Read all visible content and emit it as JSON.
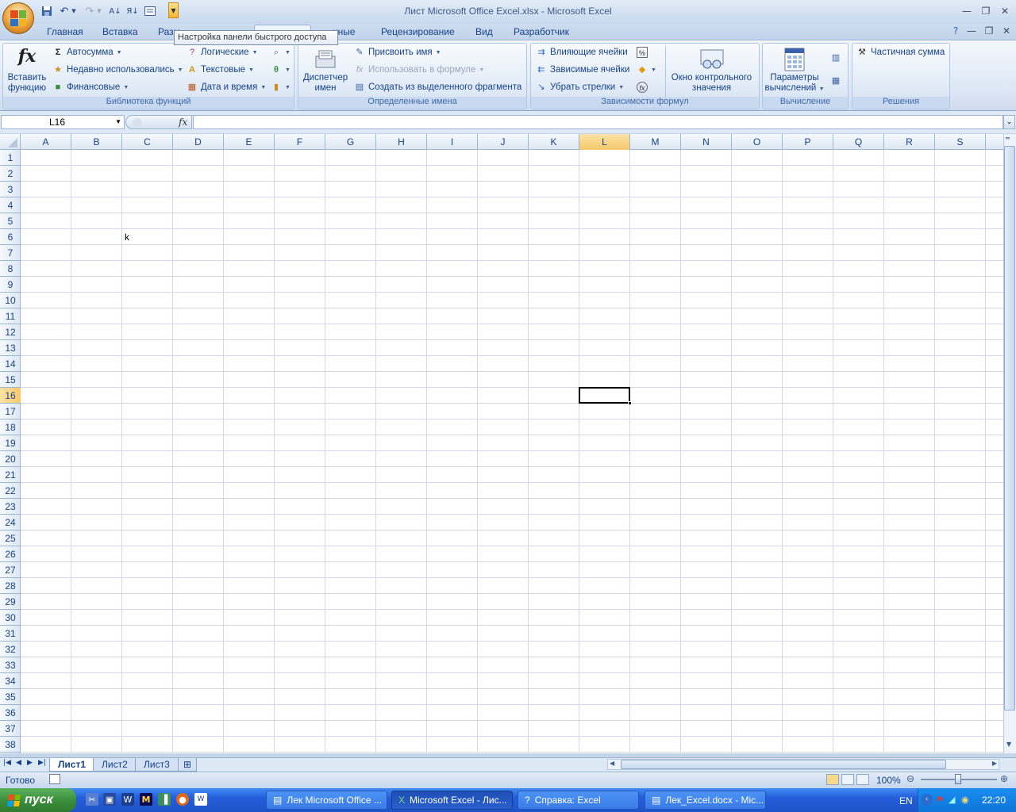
{
  "window": {
    "title": "Лист Microsoft Office Excel.xlsx - Microsoft Excel"
  },
  "qat": {
    "tooltip": "Настройка панели быстрого доступа"
  },
  "tabs": [
    {
      "label": "Главная"
    },
    {
      "label": "Вставка"
    },
    {
      "label": "Разм"
    },
    {
      "label": "нные"
    },
    {
      "label": "Рецензирование"
    },
    {
      "label": "Вид"
    },
    {
      "label": "Разработчик"
    }
  ],
  "ribbon": {
    "func_library": {
      "label": "Библиотека функций",
      "insert_function": [
        "Вставить",
        "функцию"
      ],
      "autosum": "Автосумма",
      "recent": "Недавно использовались",
      "financial": "Финансовые",
      "logical": "Логические",
      "text": "Текстовые",
      "datetime": "Дата и время"
    },
    "defined_names": {
      "label": "Определенные имена",
      "name_manager": [
        "Диспетчер",
        "имен"
      ],
      "define_name": "Присвоить имя",
      "use_in_formula": "Использовать в формуле",
      "create_from_selection": "Создать из выделенного фрагмента"
    },
    "formula_auditing": {
      "label": "Зависимости формул",
      "trace_precedents": "Влияющие ячейки",
      "trace_dependents": "Зависимые ячейки",
      "remove_arrows": "Убрать стрелки",
      "watch_window": [
        "Окно контрольного",
        "значения"
      ]
    },
    "calculation": {
      "label": "Вычисление",
      "options": [
        "Параметры",
        "вычислений"
      ]
    },
    "solutions": {
      "label": "Решения",
      "partial_sum": "Частичная сумма"
    }
  },
  "formula_bar": {
    "name_box": "L16",
    "fx_symbol": "fx",
    "value": ""
  },
  "grid": {
    "columns": [
      "A",
      "B",
      "C",
      "D",
      "E",
      "F",
      "G",
      "H",
      "I",
      "J",
      "K",
      "L",
      "M",
      "N",
      "O",
      "P",
      "Q",
      "R",
      "S"
    ],
    "rows": [
      "1",
      "2",
      "3",
      "4",
      "5",
      "6",
      "7",
      "8",
      "9",
      "10",
      "11",
      "12",
      "13",
      "14",
      "15",
      "16",
      "17",
      "18",
      "19",
      "20",
      "21",
      "22",
      "23",
      "24",
      "25",
      "26",
      "27",
      "28",
      "29",
      "30",
      "31",
      "32",
      "33",
      "34",
      "35",
      "36",
      "37",
      "38"
    ],
    "selected_column": "L",
    "selected_row": "16",
    "cells": [
      {
        "ref": "C6",
        "value": "k"
      }
    ]
  },
  "sheets": [
    {
      "label": "Лист1",
      "active": true
    },
    {
      "label": "Лист2",
      "active": false
    },
    {
      "label": "Лист3",
      "active": false
    }
  ],
  "status": {
    "ready": "Готово",
    "zoom": "100%"
  },
  "taskbar": {
    "start": "пуск",
    "tasks": [
      {
        "label": "Лек Microsoft Office ...",
        "active": false
      },
      {
        "label": "Microsoft Excel - Лис...",
        "active": true
      },
      {
        "label": "Справка: Excel",
        "active": false
      },
      {
        "label": "Лек_Excel.docx - Mic...",
        "active": false
      }
    ],
    "lang": "EN",
    "clock": "22:20"
  }
}
